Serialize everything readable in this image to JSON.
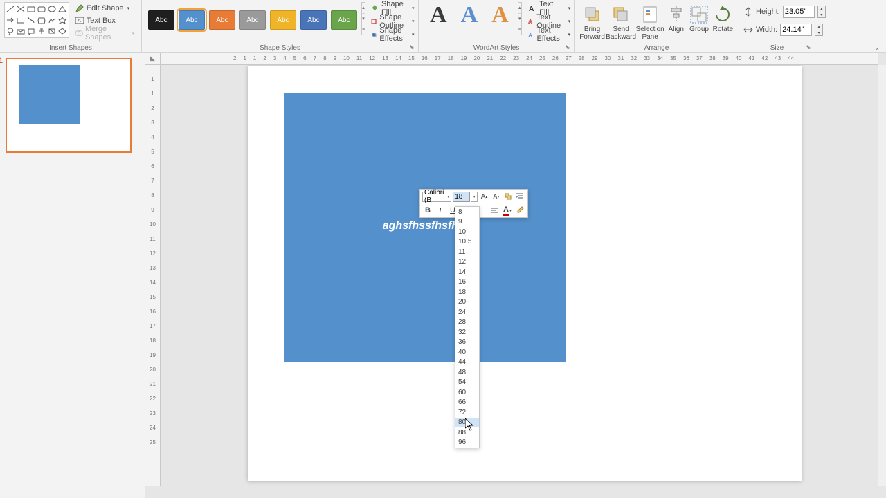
{
  "ribbon": {
    "insert_shapes": {
      "label": "Insert Shapes",
      "edit_shape": "Edit Shape",
      "text_box": "Text Box",
      "merge_shapes": "Merge Shapes"
    },
    "shape_styles": {
      "label": "Shape Styles",
      "swatches": [
        {
          "bg": "#1f1f1f",
          "txt": "Abc"
        },
        {
          "bg": "#5490cc",
          "txt": "Abc"
        },
        {
          "bg": "#e87b35",
          "txt": "Abc"
        },
        {
          "bg": "#9a9a9a",
          "txt": "Abc"
        },
        {
          "bg": "#f0b429",
          "txt": "Abc"
        },
        {
          "bg": "#4a74b8",
          "txt": "Abc"
        },
        {
          "bg": "#6aa54b",
          "txt": "Abc"
        }
      ],
      "fill": "Shape Fill",
      "outline": "Shape Outline",
      "effects": "Shape Effects"
    },
    "wordart": {
      "label": "WordArt Styles",
      "colors": [
        "#3a3a3a",
        "#5a8fcf",
        "#e09040"
      ],
      "fill": "Text Fill",
      "outline": "Text Outline",
      "effects": "Text Effects"
    },
    "arrange": {
      "label": "Arrange",
      "bring": "Bring\nForward",
      "send": "Send\nBackward",
      "sel": "Selection\nPane",
      "align": "Align",
      "group": "Group",
      "rotate": "Rotate"
    },
    "size": {
      "label": "Size",
      "height_lbl": "Height:",
      "width_lbl": "Width:",
      "height": "23.05\"",
      "width": "24.14\""
    }
  },
  "thumb": {
    "num": "1"
  },
  "shape_text": "aghsfhssfhsfhsf",
  "mini_toolbar": {
    "font": "Calibri (B",
    "size": "18"
  },
  "font_sizes": [
    "8",
    "9",
    "10",
    "10.5",
    "11",
    "12",
    "14",
    "16",
    "18",
    "20",
    "24",
    "28",
    "32",
    "36",
    "40",
    "44",
    "48",
    "54",
    "60",
    "66",
    "72",
    "80",
    "88",
    "96"
  ],
  "hover_size": "80",
  "ruler_h": [
    "2",
    "1",
    "1",
    "2",
    "3",
    "4",
    "5",
    "6",
    "7",
    "8",
    "9",
    "10",
    "11",
    "12",
    "13",
    "14",
    "15",
    "16",
    "17",
    "18",
    "19",
    "20",
    "21",
    "22",
    "23",
    "24",
    "25",
    "26",
    "27",
    "28",
    "29",
    "30",
    "31",
    "32",
    "33",
    "34",
    "35",
    "36",
    "37",
    "38",
    "39",
    "40",
    "41",
    "42",
    "43",
    "44"
  ],
  "ruler_v": [
    "1",
    "1",
    "2",
    "3",
    "4",
    "5",
    "6",
    "7",
    "8",
    "9",
    "10",
    "11",
    "12",
    "13",
    "14",
    "15",
    "16",
    "17",
    "18",
    "19",
    "20",
    "21",
    "22",
    "23",
    "24",
    "25"
  ]
}
